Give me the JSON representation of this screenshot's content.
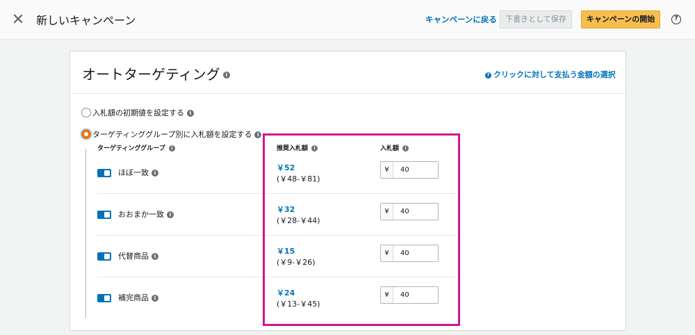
{
  "header": {
    "title": "新しいキャンペーン",
    "back_link": "キャンペーンに戻る",
    "save_draft": "下書きとして保存",
    "start": "キャンペーンの開始",
    "help_glyph": "?"
  },
  "card": {
    "title": "オートターゲティング",
    "help_link": "クリックに対して支払う金額の選択"
  },
  "bidding": {
    "option_default": "入札額の初期値を設定する",
    "option_group": "ターゲティンググループ別に入札額を設定する",
    "selected": "option_group"
  },
  "columns": {
    "group": "ターゲティンググループ",
    "suggested": "推奨入札額",
    "bid": "入札額"
  },
  "rows": [
    {
      "name": "ほぼ一致",
      "enabled": true,
      "suggested": "￥52",
      "range": "(￥48-￥81)",
      "currency": "¥",
      "bid": "40"
    },
    {
      "name": "おおまか一致",
      "enabled": true,
      "suggested": "￥32",
      "range": "(￥28-￥44)",
      "currency": "¥",
      "bid": "40"
    },
    {
      "name": "代替商品",
      "enabled": true,
      "suggested": "￥15",
      "range": "(￥9-￥26)",
      "currency": "¥",
      "bid": "40"
    },
    {
      "name": "補完商品",
      "enabled": true,
      "suggested": "￥24",
      "range": "(￥13-￥45)",
      "currency": "¥",
      "bid": "40"
    }
  ],
  "colors": {
    "accent_link": "#0073bb",
    "primary_button": "#f7be4e",
    "highlight_frame": "#d2148c",
    "radio_selected": "#ec7211"
  }
}
